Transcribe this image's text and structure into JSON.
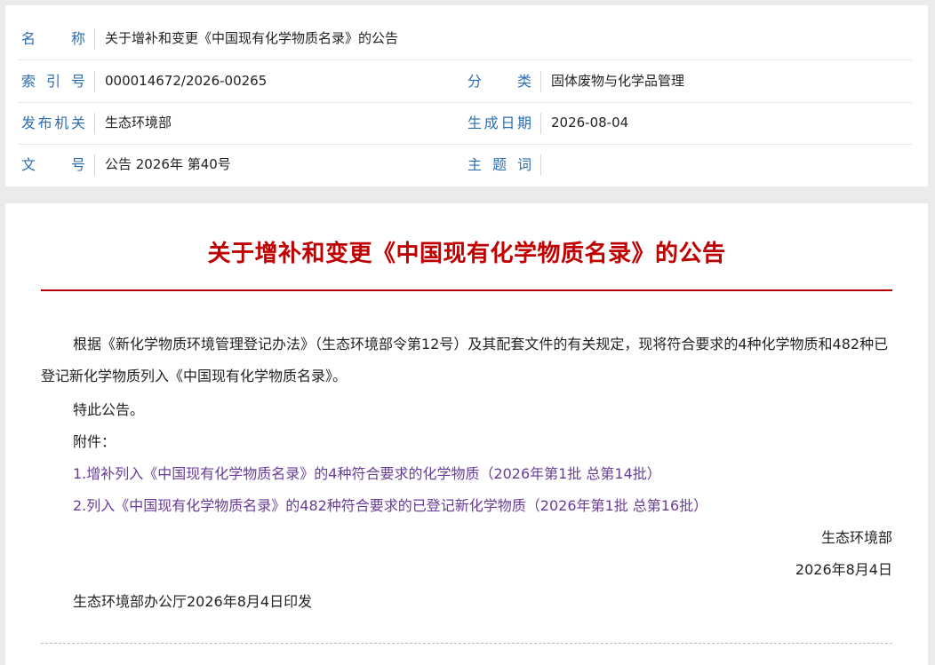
{
  "meta": {
    "name": {
      "label": "名称",
      "value": "关于增补和变更《中国现有化学物质名录》的公告"
    },
    "index": {
      "label": "索引号",
      "value": "000014672/2026-00265"
    },
    "category": {
      "label": "分类",
      "value": "固体废物与化学品管理"
    },
    "issuer": {
      "label": "发布机关",
      "value": "生态环境部"
    },
    "date": {
      "label": "生成日期",
      "value": "2026-08-04"
    },
    "doc_no": {
      "label": "文号",
      "value": "公告 2026年 第40号"
    },
    "subject": {
      "label": "主题词",
      "value": ""
    }
  },
  "article": {
    "title": "关于增补和变更《中国现有化学物质名录》的公告",
    "body": "根据《新化学物质环境管理登记办法》（生态环境部令第12号）及其配套文件的有关规定，现将符合要求的4种化学物质和482种已登记新化学物质列入《中国现有化学物质名录》。",
    "notice": "特此公告。",
    "attachments_label": "附件：",
    "attachments": [
      "1.增补列入《中国现有化学物质名录》的4种符合要求的化学物质（2026年第1批 总第14批）",
      "2.列入《中国现有化学物质名录》的482种符合要求的已登记新化学物质（2026年第1批 总第16批）"
    ],
    "signature": "生态环境部",
    "sign_date": "2026年8月4日",
    "footer": "生态环境部办公厅2026年8月4日印发"
  }
}
